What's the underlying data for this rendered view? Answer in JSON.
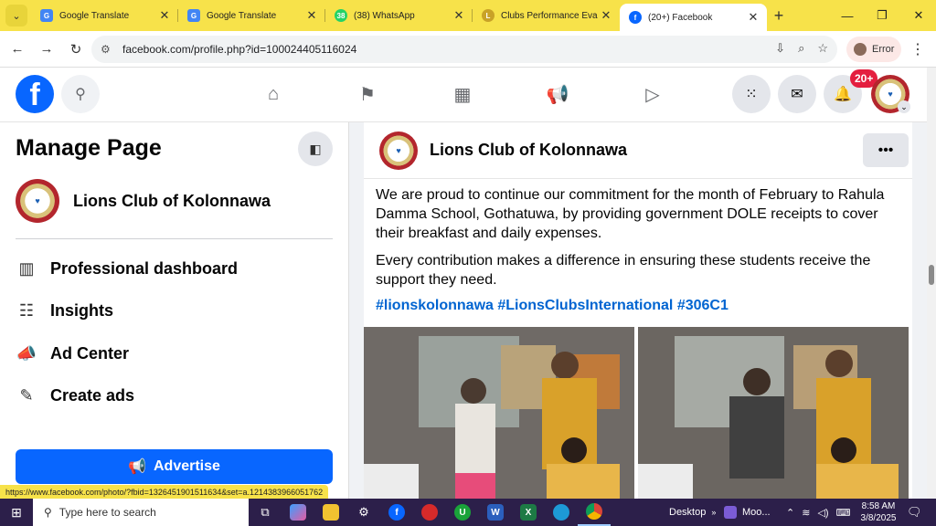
{
  "browser": {
    "tabs": [
      {
        "label": "Google Translate",
        "icon": "google-translate-icon",
        "color": "#4285f4"
      },
      {
        "label": "Google Translate",
        "icon": "google-translate-icon",
        "color": "#4285f4"
      },
      {
        "label": "(38) WhatsApp",
        "icon": "whatsapp-icon",
        "color": "#25d366",
        "badge": "38"
      },
      {
        "label": "Clubs Performance Evalu",
        "icon": "lions-icon",
        "color": "#c9a227"
      },
      {
        "label": "(20+) Facebook",
        "icon": "facebook-icon",
        "color": "#0866ff",
        "active": true
      }
    ],
    "url": "facebook.com/profile.php?id=100024405116024",
    "profile_label": "Error",
    "status_url": "https://www.facebook.com/photo/?fbid=1326451901511634&set=a.1214383966051762"
  },
  "facebook": {
    "notifications_badge": "20+",
    "nav_icons": [
      "home-icon",
      "flag-icon",
      "dashboard-icon",
      "megaphone-icon",
      "video-icon"
    ]
  },
  "sidebar": {
    "title": "Manage Page",
    "page_name": "Lions Club of Kolonnawa",
    "menu": [
      {
        "label": "Professional dashboard",
        "icon": "dashboard-icon"
      },
      {
        "label": "Insights",
        "icon": "insights-icon"
      },
      {
        "label": "Ad Center",
        "icon": "megaphone-icon"
      },
      {
        "label": "Create ads",
        "icon": "edit-icon"
      }
    ],
    "advertise_label": "Advertise"
  },
  "post": {
    "author": "Lions Club of Kolonnawa",
    "paragraph1": "We are proud to continue our commitment for the month of February to Rahula Damma School, Gothatuwa, by providing government DOLE receipts to cover their breakfast and daily expenses.",
    "paragraph2": "Every contribution makes a difference in ensuring these students receive the support they need.",
    "hashtags": "#lionskolonnawa #LionsClubsInternational #306C1"
  },
  "taskbar": {
    "search_placeholder": "Type here to search",
    "desktop_label": "Desktop",
    "moo_label": "Moo...",
    "time": "8:58 AM",
    "date": "3/8/2025"
  }
}
